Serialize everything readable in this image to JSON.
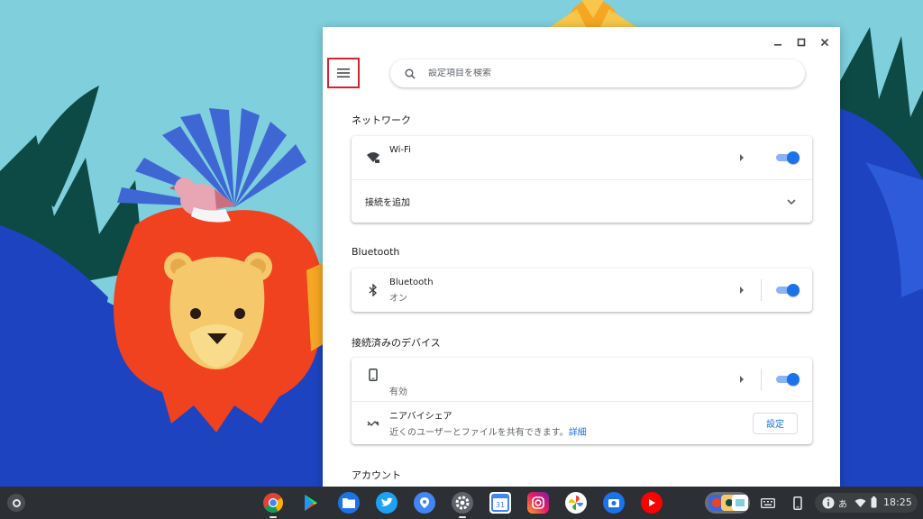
{
  "window": {
    "search_placeholder": "設定項目を検索"
  },
  "network": {
    "title": "ネットワーク",
    "wifi_label": "Wi-Fi",
    "add_connection_label": "接続を追加"
  },
  "bluetooth": {
    "title": "Bluetooth",
    "label": "Bluetooth",
    "status": "オン"
  },
  "connected_devices": {
    "title": "接続済みのデバイス",
    "phone_status": "有効",
    "nearby_share_label": "ニアバイシェア",
    "nearby_share_desc": "近くのユーザーとファイルを共有できます。",
    "nearby_share_link": "詳細",
    "settings_button": "設定"
  },
  "account": {
    "title": "アカウント"
  },
  "shelf": {
    "apps": [
      "chrome-icon",
      "play-store-icon",
      "files-icon",
      "twitter-icon",
      "maps-icon",
      "settings-icon",
      "calendar-icon",
      "instagram-icon",
      "photos-icon",
      "camera-icon",
      "youtube-icon"
    ],
    "ime_label": "あ",
    "clock": "18:25"
  },
  "colors": {
    "accent": "#1a73e8",
    "highlight_border": "#d3232f",
    "shelf": "#2c2f33"
  }
}
